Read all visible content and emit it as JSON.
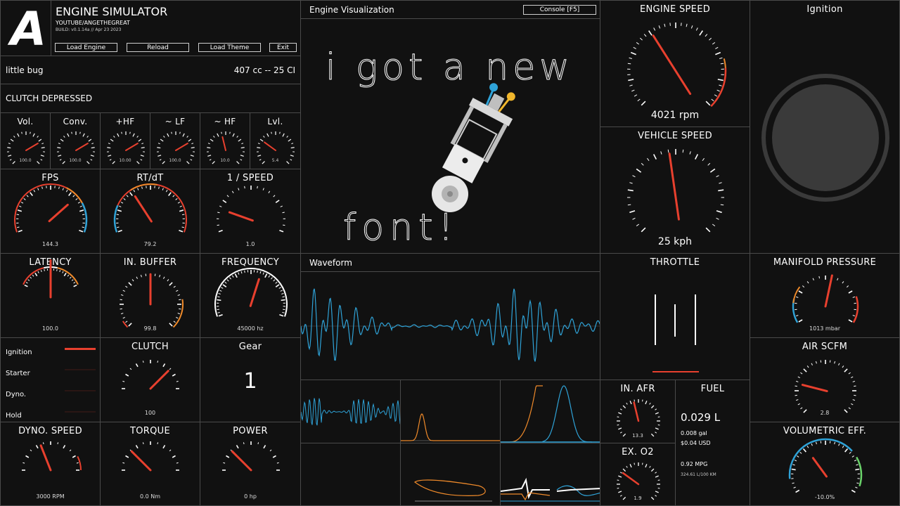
{
  "header": {
    "logo": "A",
    "app_title": "ENGINE SIMULATOR",
    "channel": "YOUTUBE/ANGETHEGREAT",
    "build": "BUILD: v0.1.14a // Apr 23 2023",
    "buttons": {
      "load_engine": "Load Engine",
      "reload": "Reload",
      "load_theme": "Load Theme",
      "exit": "Exit"
    }
  },
  "engine": {
    "name": "little bug",
    "displacement": "407 cc -- 25 CI"
  },
  "clutch_status": "CLUTCH DEPRESSED",
  "audio": {
    "titles": [
      "Vol.",
      "Conv.",
      "+HF",
      "~ LF",
      "~ HF",
      "Lvl."
    ],
    "values": [
      "100.0",
      "100.0",
      "10.00",
      "100.0",
      "10.0",
      "5.4"
    ]
  },
  "viz": {
    "title": "Engine Visualization",
    "console_button": "Console [F5]",
    "note_line1": "i got a new",
    "note_line2": "font!"
  },
  "engine_speed": {
    "title": "ENGINE SPEED",
    "value": "4021 rpm"
  },
  "vehicle_speed": {
    "title": "VEHICLE SPEED",
    "value": "25 kph"
  },
  "ignition_panel": {
    "title": "Ignition"
  },
  "perf": {
    "fps": {
      "title": "FPS",
      "value": "144.3"
    },
    "rt": {
      "title": "RT/dT",
      "value": "79.2"
    },
    "inv_speed": {
      "title": "1 / SPEED",
      "value": "1.0"
    },
    "latency": {
      "title": "LATENCY",
      "value": "100.0"
    },
    "in_buffer": {
      "title": "IN. BUFFER",
      "value": "99.8"
    },
    "frequency": {
      "title": "FREQUENCY",
      "value": "45000 hz"
    }
  },
  "waveform": {
    "title": "Waveform"
  },
  "throttle": {
    "title": "THROTTLE"
  },
  "manifold": {
    "title": "MANIFOLD PRESSURE",
    "value": "1013 mbar"
  },
  "air_scfm": {
    "title": "AIR SCFM",
    "value": "2.8"
  },
  "volumetric": {
    "title": "VOLUMETRIC EFF.",
    "value": "-10.0%"
  },
  "toggles": {
    "ignition": "Ignition",
    "starter": "Starter",
    "dyno": "Dyno.",
    "hold": "Hold"
  },
  "clutch": {
    "title": "CLUTCH",
    "value": "100"
  },
  "gear": {
    "title": "Gear",
    "value": "1"
  },
  "dyno_speed": {
    "title": "DYNO. SPEED",
    "value": "3000 RPM"
  },
  "torque": {
    "title": "TORQUE",
    "value": "0.0 Nm"
  },
  "power": {
    "title": "POWER",
    "value": "0 hp"
  },
  "in_afr": {
    "title": "IN. AFR",
    "value": "13.3"
  },
  "ex_o2": {
    "title": "EX. O2",
    "value": "1.9"
  },
  "fuel": {
    "title": "FUEL",
    "liters": "0.029 L",
    "gallons": "0.008 gal",
    "cost": "$0.04 USD",
    "mpg": "0.92 MPG",
    "l_per_km": "324.61 L/100 KM"
  },
  "colors": {
    "background": "#111111",
    "border": "#4a4a4a",
    "needle": "#e8402e",
    "orange": "#ef8a2a",
    "blue": "#2fa3d8",
    "green": "#6ad36a"
  }
}
